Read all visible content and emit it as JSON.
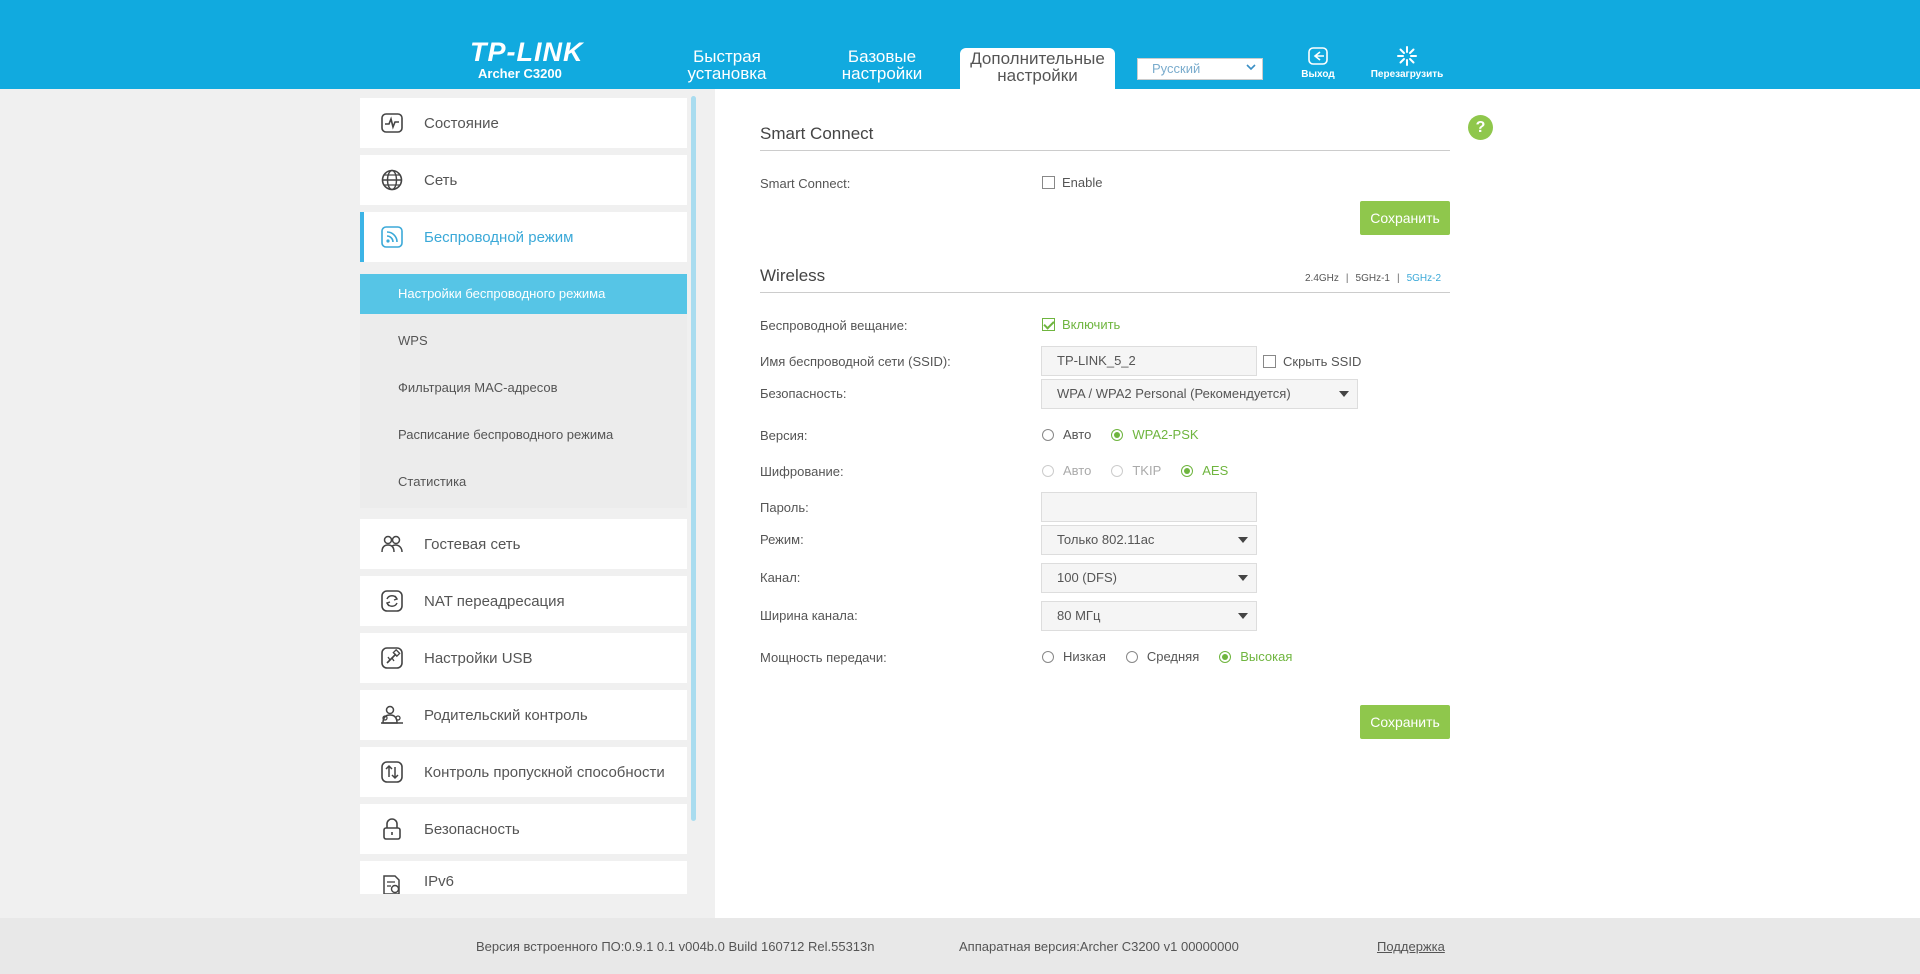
{
  "header": {
    "logo": "TP-LINK",
    "model": "Archer C3200",
    "tabs": [
      {
        "line1": "Быстрая",
        "line2": "установка"
      },
      {
        "line1": "Базовые",
        "line2": "настройки"
      },
      {
        "line1": "Дополнительные",
        "line2": "настройки"
      }
    ],
    "language": "Русский",
    "logout": "Выход",
    "reboot": "Перезагрузить"
  },
  "sidebar": {
    "items": [
      {
        "label": "Состояние",
        "icon": "status-icon"
      },
      {
        "label": "Сеть",
        "icon": "globe-icon"
      },
      {
        "label": "Беспроводной режим",
        "icon": "wireless-icon"
      },
      {
        "label": "Гостевая сеть",
        "icon": "guest-icon"
      },
      {
        "label": "NAT переадресация",
        "icon": "nat-icon"
      },
      {
        "label": "Настройки USB",
        "icon": "usb-icon"
      },
      {
        "label": "Родительский контроль",
        "icon": "parental-icon"
      },
      {
        "label": "Контроль пропускной способности",
        "icon": "bandwidth-icon"
      },
      {
        "label": "Безопасность",
        "icon": "lock-icon"
      },
      {
        "label": "IPv6",
        "icon": "ipv6-icon"
      }
    ],
    "submenu": [
      "Настройки беспроводного режима",
      "WPS",
      "Фильтрация MAC-адресов",
      "Расписание беспроводного режима",
      "Статистика"
    ]
  },
  "smart_connect": {
    "title": "Smart Connect",
    "label": "Smart Connect:",
    "enable": "Enable",
    "save": "Сохранить"
  },
  "wireless": {
    "title": "Wireless",
    "bands": [
      "2.4GHz",
      "5GHz-1",
      "5GHz-2"
    ],
    "broadcast_label": "Беспроводной вещание:",
    "broadcast_enable": "Включить",
    "ssid_label": "Имя беспроводной сети (SSID):",
    "ssid_value": "TP-LINK_5_2",
    "hide_ssid": "Скрыть SSID",
    "security_label": "Безопасность:",
    "security_value": "WPA / WPA2 Personal (Рекомендуется)",
    "version_label": "Версия:",
    "version_opts": [
      "Авто",
      "WPA2-PSK"
    ],
    "encryption_label": "Шифрование:",
    "encryption_opts": [
      "Авто",
      "TKIP",
      "AES"
    ],
    "password_label": "Пароль:",
    "password_value": "",
    "mode_label": "Режим:",
    "mode_value": "Только 802.11ac",
    "channel_label": "Канал:",
    "channel_value": "100 (DFS)",
    "width_label": "Ширина канала:",
    "width_value": "80 МГц",
    "power_label": "Мощность передачи:",
    "power_opts": [
      "Низкая",
      "Средняя",
      "Высокая"
    ],
    "save": "Сохранить"
  },
  "footer": {
    "firmware": "Версия встроенного ПО:0.9.1 0.1 v004b.0 Build 160712 Rel.55313n",
    "hardware": "Аппаратная версия:Archer C3200 v1 00000000",
    "support": "Поддержка"
  },
  "colors": {
    "header": "#11aadf",
    "accent_green": "#8fc74c",
    "active_blue": "#56c5e6"
  }
}
